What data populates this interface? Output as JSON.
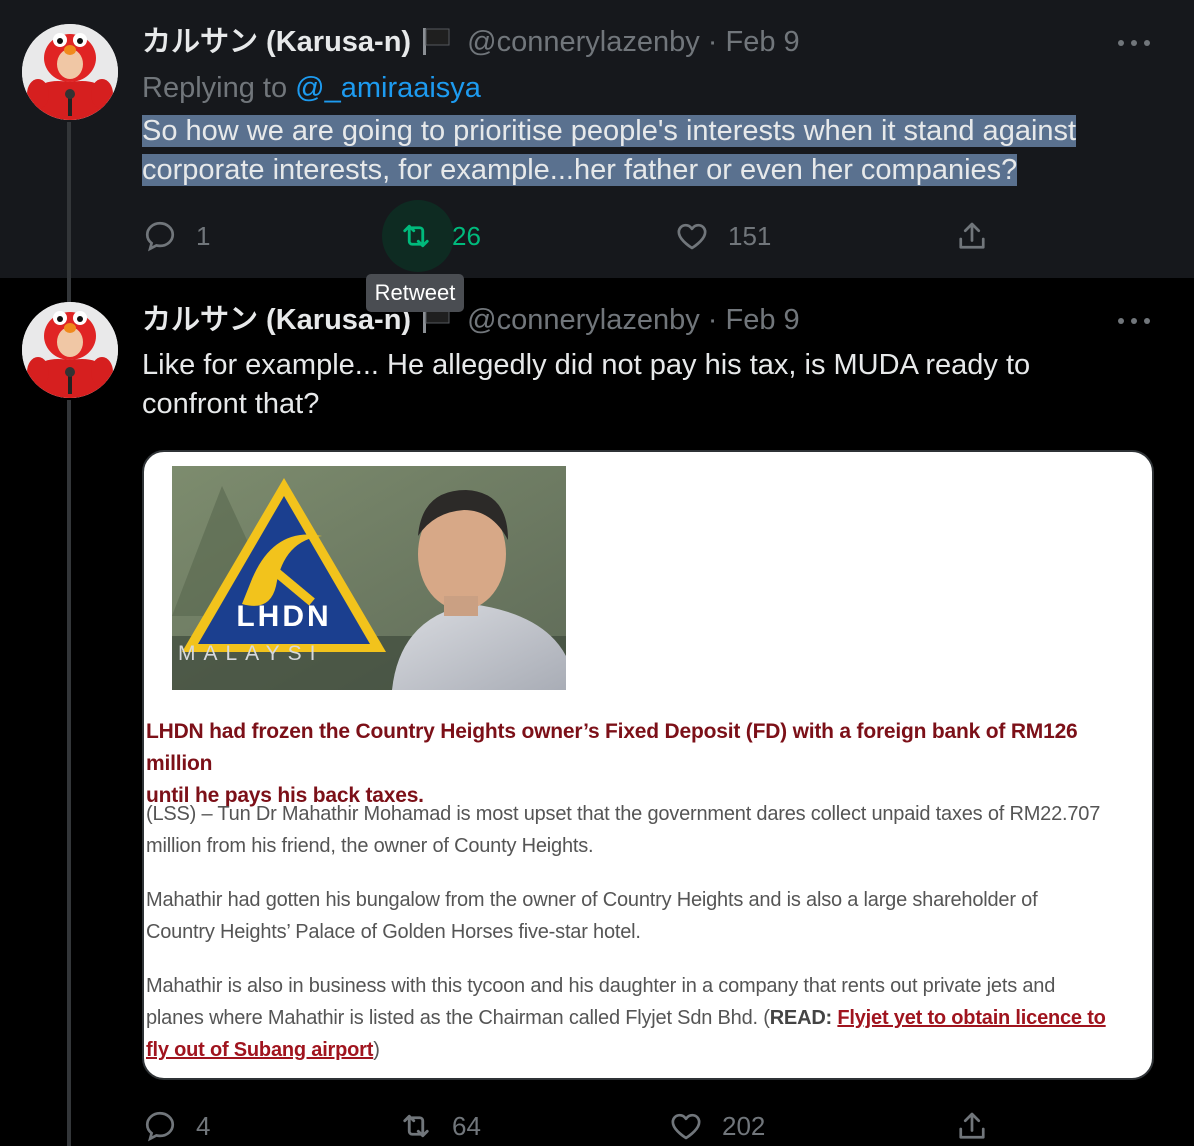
{
  "tweets": [
    {
      "display_name": "カルサン (Karusa-n)",
      "handle": "@connerylazenby",
      "separator": "·",
      "date": "Feb 9",
      "replying_label": "Replying to",
      "replying_to": "@_amiraaisya",
      "text_line1": "So how we are going to prioritise people's interests when it stand against",
      "text_line2": "corporate interests, for example...her father or even her companies?",
      "replies": "1",
      "retweets": "26",
      "likes": "151"
    },
    {
      "display_name": "カルサン (Karusa-n)",
      "handle": "@connerylazenby",
      "separator": "·",
      "date": "Feb 9",
      "text_line1": "Like for example... He allegedly did not pay his tax, is MUDA ready to",
      "text_line2": "confront that?",
      "replies": "4",
      "retweets": "64",
      "likes": "202"
    }
  ],
  "tooltip": "Retweet",
  "article": {
    "logo_text": "LHDN",
    "logo_subtext": "MALAYSI",
    "lead_line1": "LHDN had frozen the Country Heights owner’s Fixed Deposit (FD) with a foreign bank of RM126 million",
    "lead_line2": "until he pays his back taxes.",
    "p1_line1": "(LSS) – Tun Dr Mahathir Mohamad is most upset that the government dares collect unpaid taxes of RM22.707",
    "p1_line2": "million from his friend, the owner of County Heights.",
    "p2_line1": "Mahathir had gotten his bungalow from the owner of Country Heights and is also a large shareholder of",
    "p2_line2": "Country Heights’ Palace of Golden Horses five-star hotel.",
    "p3_line1": "Mahathir is also in business with this tycoon and his daughter in a company that rents out private jets and",
    "p3_line2_pre": "planes where Mahathir is listed as the Chairman called Flyjet Sdn Bhd. (",
    "p3_read": "READ:",
    "p3_link_part1": "Flyjet yet to obtain licence to",
    "p3_link_part2": "fly out of Subang airport",
    "p3_close": ")"
  },
  "colors": {
    "background": "#000000",
    "selected_tweet_bg": "#16181c",
    "text_selection": "#5a718f",
    "accent_blue": "#1d9bf0",
    "retweet_green": "#00ba7c",
    "muted": "#71767b",
    "article_red": "#7c1018"
  },
  "icons": [
    "flag-icon",
    "more-icon",
    "reply-icon",
    "retweet-icon",
    "like-icon",
    "share-icon"
  ]
}
